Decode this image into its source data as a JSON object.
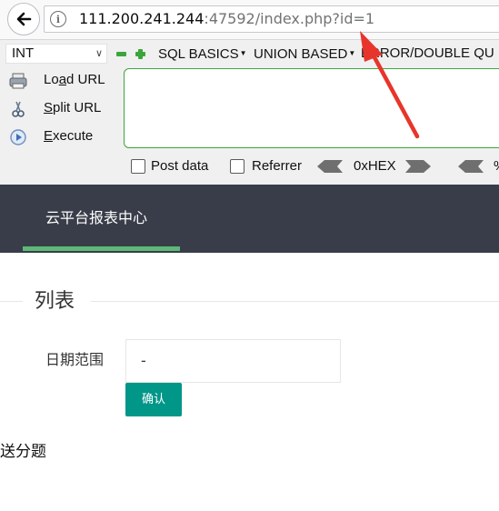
{
  "browser": {
    "url_host": "111.200.241.244",
    "url_rest": ":47592/index.php?id=1",
    "info_icon": "i"
  },
  "hackbar": {
    "type_value": "INT",
    "menu": [
      "SQL BASICS",
      "UNION BASED",
      "ERROR/DOUBLE QU"
    ],
    "load_url_pre": "Lo",
    "load_url_u": "a",
    "load_url_post": "d URL",
    "split_url_u": "S",
    "split_url_post": "plit URL",
    "execute_u": "E",
    "execute_post": "xecute",
    "post_data_label": "Post data",
    "referrer_label": "Referrer",
    "hex_label": "0xHEX",
    "trailing_char": "%"
  },
  "app": {
    "nav_title": "云平台报表中心",
    "section_title": "列表",
    "date_label": "日期范围",
    "date_value": "-",
    "confirm_label": "确认",
    "footer_text": "送分题"
  },
  "colors": {
    "annotation": "#e8352b",
    "nav_bg": "#393d49",
    "nav_active": "#5fb878",
    "button": "#009688"
  },
  "icons": [
    "back-arrow-icon",
    "info-icon",
    "minus-icon",
    "plus-icon",
    "load-url-icon",
    "split-url-icon",
    "execute-icon",
    "hex-left-arrow-icon",
    "hex-right-arrow-icon"
  ]
}
